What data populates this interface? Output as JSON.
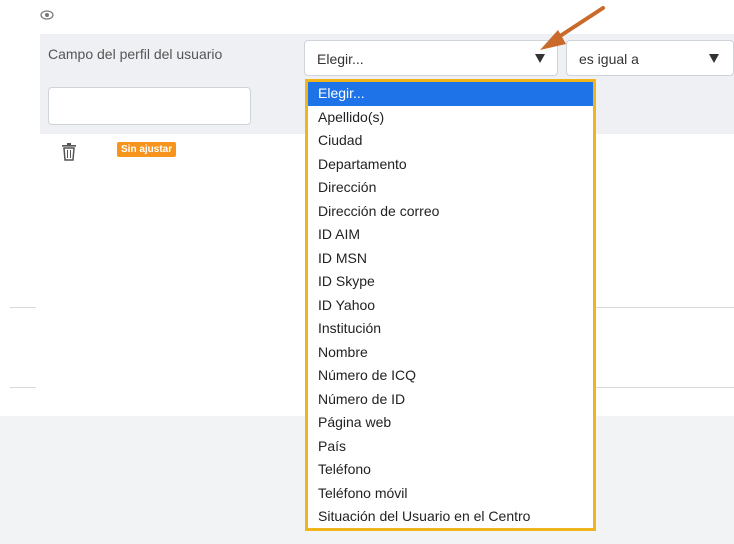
{
  "filter": {
    "field_label": "Campo del perfil del usuario",
    "field_select_value": "Elegir...",
    "operator_select_value": "es igual a",
    "value_input": "",
    "status_badge": "Sin ajustar"
  },
  "dropdown": {
    "options": [
      "Elegir...",
      "Apellido(s)",
      "Ciudad",
      "Departamento",
      "Dirección",
      "Dirección de correo",
      "ID AIM",
      "ID MSN",
      "ID Skype",
      "ID Yahoo",
      "Institución",
      "Nombre",
      "Número de ICQ",
      "Número de ID",
      "Página web",
      "País",
      "Teléfono",
      "Teléfono móvil",
      "Situación del Usuario en el Centro"
    ],
    "selected_index": 0
  },
  "icons": {
    "visibility": "eye-icon",
    "delete": "trash-icon",
    "annotation": "arrow-annotation"
  },
  "colors": {
    "accent_select": "#1e73e8",
    "dropdown_border": "#f0b41c",
    "badge": "#f7941d",
    "arrow": "#c9692a"
  }
}
